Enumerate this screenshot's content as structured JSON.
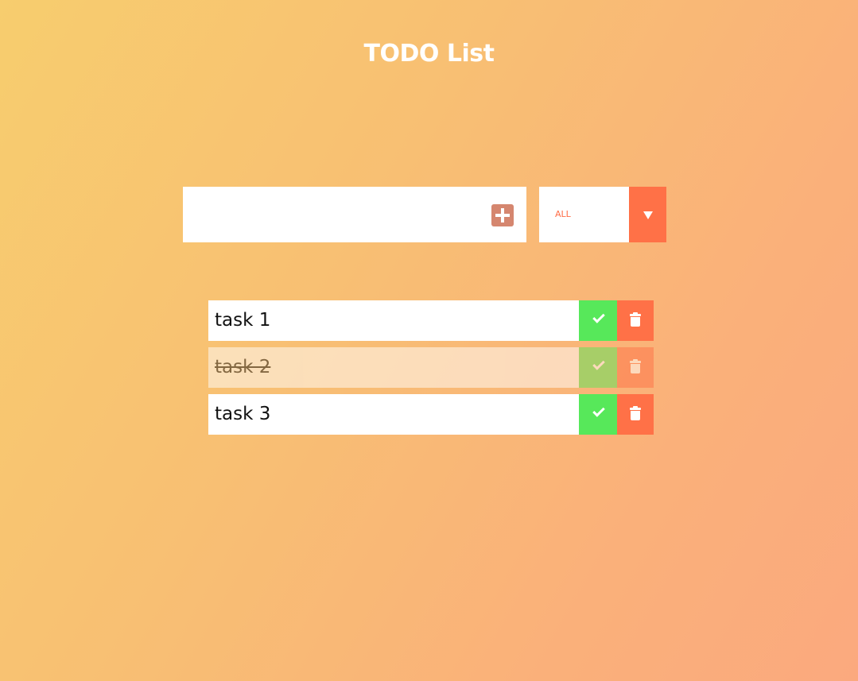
{
  "header": {
    "title": "TODO List"
  },
  "form": {
    "input_value": "",
    "add_icon": "plus-square-icon",
    "filter": {
      "selected": "ALL",
      "arrow_icon": "triangle-down-icon"
    }
  },
  "todos": [
    {
      "text": "task 1",
      "completed": false
    },
    {
      "text": "task 2",
      "completed": true
    },
    {
      "text": "task 3",
      "completed": false
    }
  ],
  "colors": {
    "complete": "#57e85a",
    "trash": "#ff7147",
    "add_button": "#d5866f",
    "filter_text": "#ff6e47"
  }
}
